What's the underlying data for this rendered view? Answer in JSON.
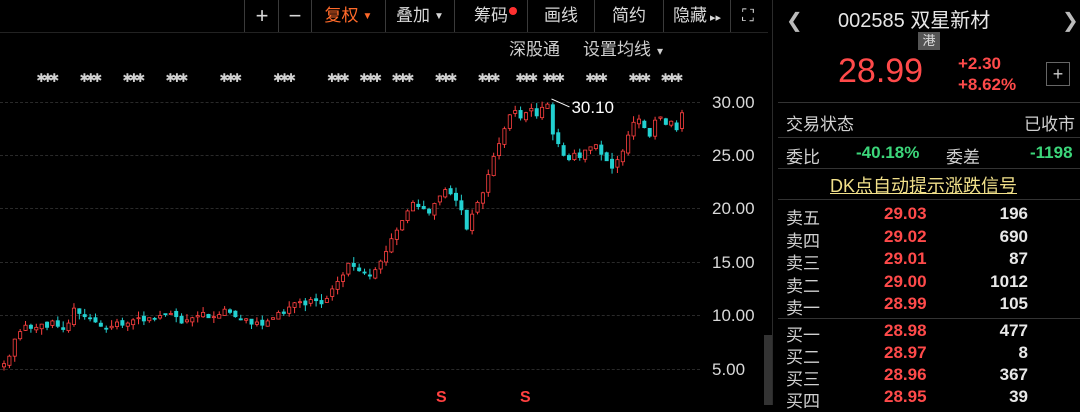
{
  "toolbar": {
    "plus": "+",
    "minus": "−",
    "fuquan": "复权",
    "diejia": "叠加",
    "chouma": "筹码",
    "huaxian": "画线",
    "jianyue": "简约",
    "yincang": "隐藏",
    "yincang_arrow": "▸▸",
    "fullscreen": "⛶"
  },
  "sublinks": {
    "shengutong": "深股通",
    "setma": "设置均线",
    "setma_arrow": "▾"
  },
  "axis": {
    "ticks": [
      "30.00",
      "25.00",
      "20.00",
      "15.00",
      "10.00",
      "5.00"
    ]
  },
  "chart_data": {
    "type": "candlestick",
    "ylim": [
      3.0,
      31.5
    ],
    "yticks": [
      30,
      25,
      20,
      15,
      10,
      5
    ],
    "annotation": {
      "text": "30.10",
      "value": 30.1
    },
    "colors": {
      "up": "#ff4040",
      "down": "#22d0d0"
    },
    "close_path": [
      5.5,
      6.2,
      7.8,
      8.5,
      9.1,
      8.8,
      8.9,
      9.2,
      8.9,
      9.5,
      9.0,
      8.7,
      9.3,
      10.7,
      10.2,
      9.9,
      9.7,
      9.4,
      9.0,
      8.8,
      9.0,
      9.4,
      9.1,
      9.3,
      9.6,
      9.8,
      9.5,
      9.8,
      9.7,
      10.0,
      10.1,
      10.2,
      9.9,
      9.3,
      9.6,
      9.8,
      10.0,
      10.3,
      9.8,
      9.9,
      10.1,
      10.6,
      10.3,
      9.9,
      9.6,
      9.7,
      9.2,
      9.4,
      9.1,
      9.5,
      9.8,
      10.3,
      10.2,
      10.8,
      11.2,
      11.3,
      11.0,
      11.5,
      11.4,
      11.1,
      11.6,
      12.5,
      13.2,
      13.8,
      14.9,
      14.6,
      14.2,
      14.0,
      13.7,
      14.3,
      15.1,
      16.0,
      17.2,
      18.0,
      18.9,
      19.8,
      20.6,
      20.2,
      20.0,
      19.6,
      20.5,
      21.2,
      21.8,
      21.4,
      20.8,
      19.9,
      18.1,
      19.5,
      20.6,
      21.5,
      23.2,
      24.9,
      26.1,
      27.5,
      28.8,
      29.2,
      28.5,
      29.0,
      29.4,
      28.7,
      29.5,
      29.8,
      27.0,
      26.1,
      25.0,
      24.6,
      25.2,
      24.8,
      25.5,
      25.8,
      26.0,
      25.1,
      24.5,
      23.8,
      24.6,
      25.4,
      26.9,
      28.1,
      28.4,
      27.6,
      26.8,
      28.3,
      28.6,
      27.9,
      28.2,
      27.4,
      28.99
    ]
  },
  "markers": {
    "s_label": "S"
  },
  "right": {
    "nav_left": "❮",
    "nav_right": "❯",
    "code": "002585",
    "name": "双星新材",
    "badge": "港",
    "price": "28.99",
    "change": "+2.30",
    "change_pct": "+8.62%",
    "plus": "+",
    "trade_status_label": "交易状态",
    "trade_status_value": "已收市",
    "weibi_label": "委比",
    "weibi_value": "-40.18%",
    "weicha_label": "委差",
    "weicha_value": "-1198",
    "dk_signal": "DK点自动提示涨跌信号",
    "sell": [
      {
        "label": "卖五",
        "price": "29.03",
        "vol": "196"
      },
      {
        "label": "卖四",
        "price": "29.02",
        "vol": "690"
      },
      {
        "label": "卖三",
        "price": "29.01",
        "vol": "87"
      },
      {
        "label": "卖二",
        "price": "29.00",
        "vol": "1012"
      },
      {
        "label": "卖一",
        "price": "28.99",
        "vol": "105"
      }
    ],
    "buy": [
      {
        "label": "买一",
        "price": "28.98",
        "vol": "477"
      },
      {
        "label": "买二",
        "price": "28.97",
        "vol": "8"
      },
      {
        "label": "买三",
        "price": "28.96",
        "vol": "367"
      },
      {
        "label": "买四",
        "price": "28.95",
        "vol": "39"
      }
    ]
  }
}
